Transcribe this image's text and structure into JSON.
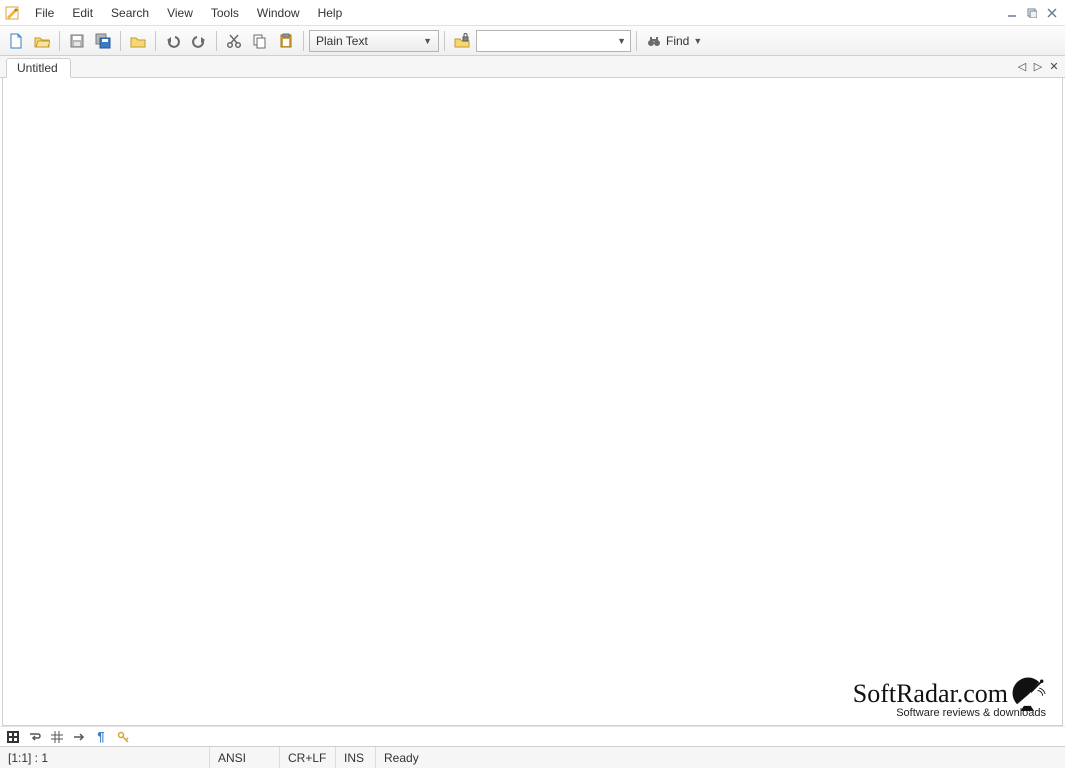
{
  "menu": {
    "items": [
      "File",
      "Edit",
      "Search",
      "View",
      "Tools",
      "Window",
      "Help"
    ]
  },
  "toolbar": {
    "syntax_value": "Plain Text",
    "find_value": "",
    "find_label": "Find"
  },
  "tabs": {
    "items": [
      {
        "label": "Untitled"
      }
    ]
  },
  "statusbar": {
    "position": "[1:1] : 1",
    "encoding": "ANSI",
    "eol": "CR+LF",
    "mode": "INS",
    "state": "Ready"
  },
  "watermark": {
    "title": "SoftRadar.com",
    "subtitle": "Software reviews & downloads"
  }
}
